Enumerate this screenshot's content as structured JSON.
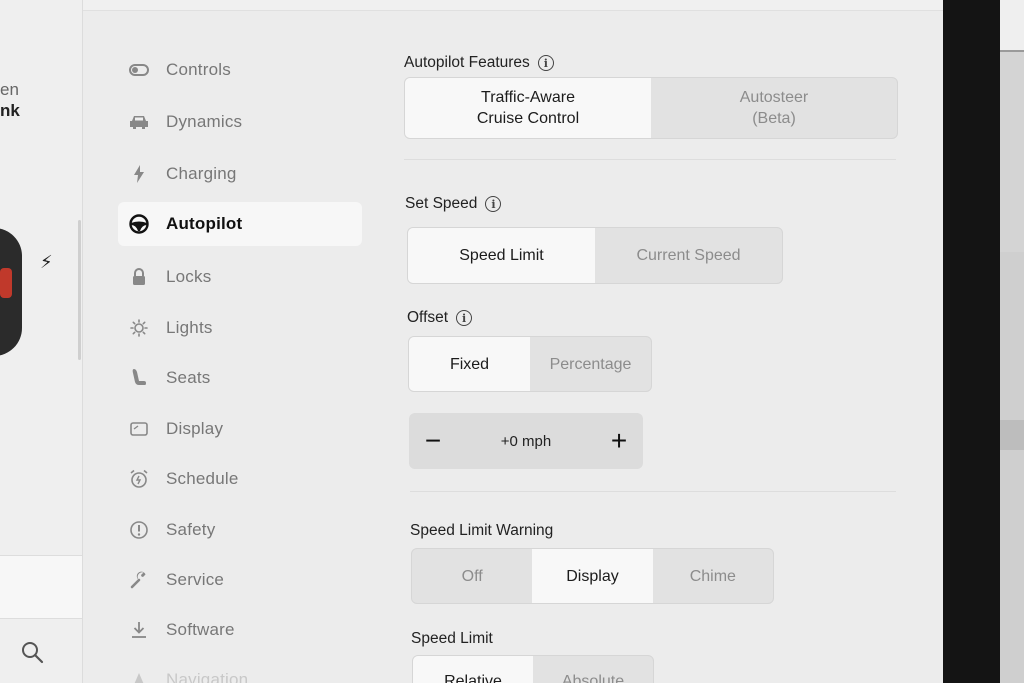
{
  "left_panel": {
    "text_line1": "en",
    "text_line2": "nk",
    "bolt": "⚡"
  },
  "nav": {
    "items": [
      {
        "label": "Controls",
        "icon": "toggle-icon"
      },
      {
        "label": "Dynamics",
        "icon": "car-icon"
      },
      {
        "label": "Charging",
        "icon": "bolt-icon"
      },
      {
        "label": "Autopilot",
        "icon": "steering-wheel-icon",
        "active": true
      },
      {
        "label": "Locks",
        "icon": "lock-icon"
      },
      {
        "label": "Lights",
        "icon": "sun-icon"
      },
      {
        "label": "Seats",
        "icon": "seat-icon"
      },
      {
        "label": "Display",
        "icon": "display-icon"
      },
      {
        "label": "Schedule",
        "icon": "alarm-clock-icon"
      },
      {
        "label": "Safety",
        "icon": "alert-icon"
      },
      {
        "label": "Service",
        "icon": "wrench-icon"
      },
      {
        "label": "Software",
        "icon": "download-icon"
      },
      {
        "label": "Navigation",
        "icon": "navigation-icon"
      }
    ]
  },
  "autopilot_features": {
    "title": "Autopilot Features",
    "options": [
      "Traffic-Aware\nCruise Control",
      "Autosteer\n(Beta)"
    ],
    "selected": 0
  },
  "set_speed": {
    "title": "Set Speed",
    "options": [
      "Speed Limit",
      "Current Speed"
    ],
    "selected": 0
  },
  "offset": {
    "title": "Offset",
    "options": [
      "Fixed",
      "Percentage"
    ],
    "selected": 0,
    "value": "+0 mph",
    "minus": "−",
    "plus": "+"
  },
  "speed_limit_warning": {
    "title": "Speed Limit Warning",
    "options": [
      "Off",
      "Display",
      "Chime"
    ],
    "selected": 1
  },
  "speed_limit": {
    "title": "Speed Limit",
    "options": [
      "Relative",
      "Absolute"
    ],
    "selected": 0
  }
}
